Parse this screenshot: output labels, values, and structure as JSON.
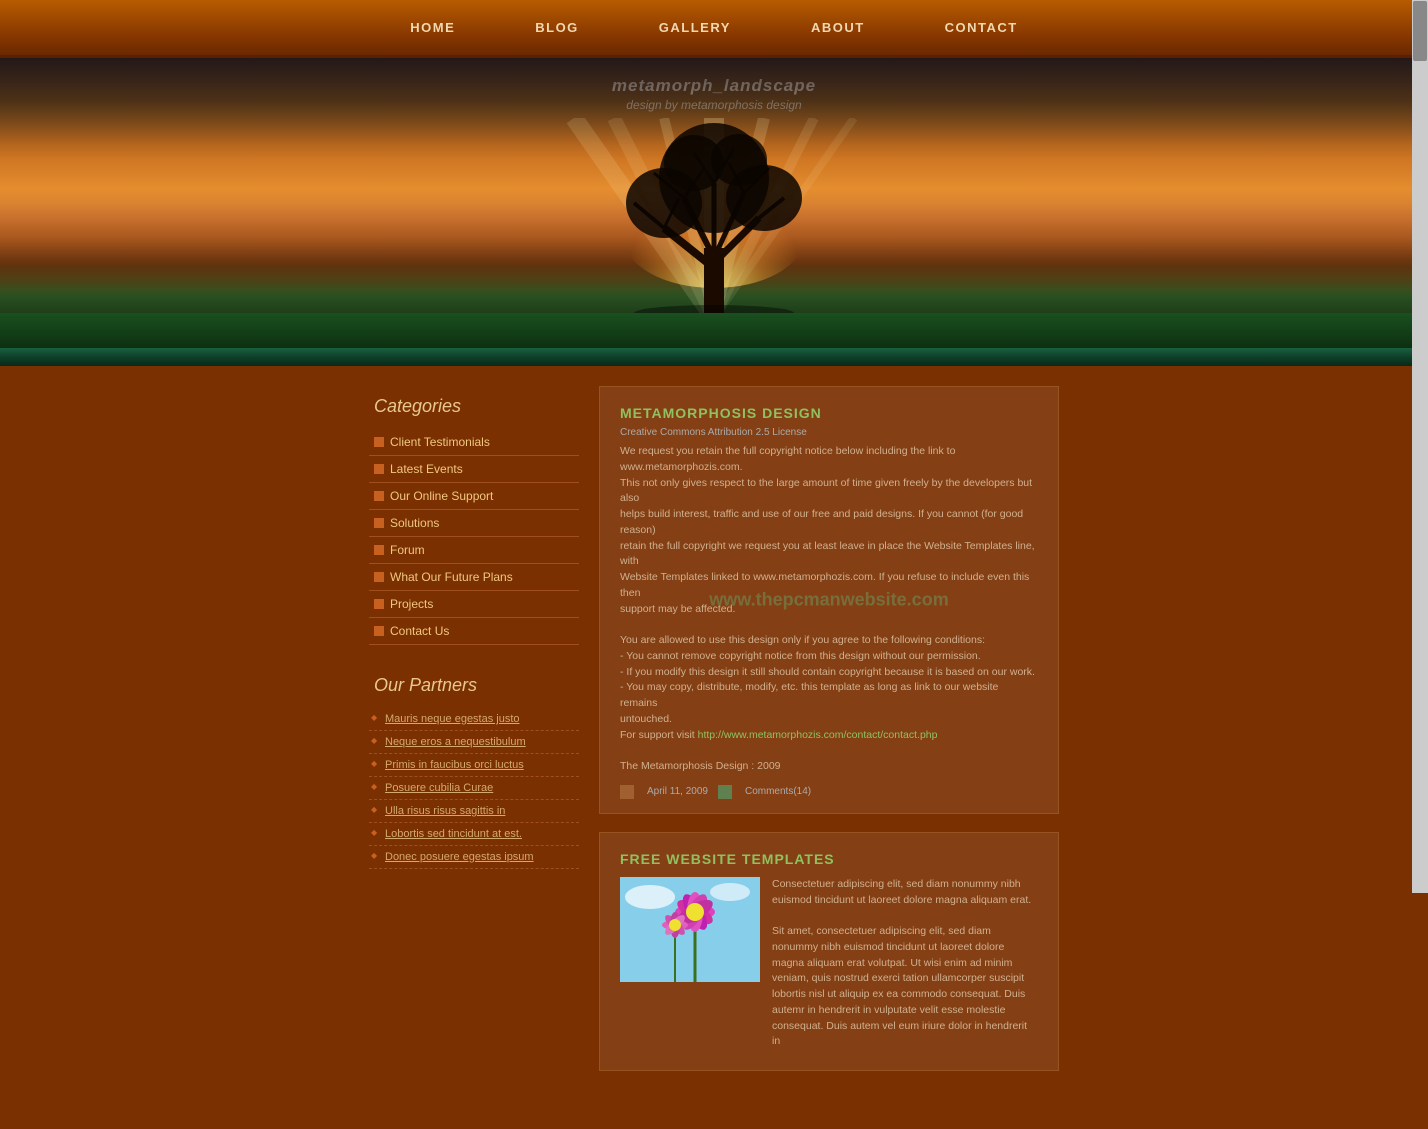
{
  "nav": {
    "items": [
      {
        "label": "HOME",
        "href": "#"
      },
      {
        "label": "BLOG",
        "href": "#"
      },
      {
        "label": "GALLERY",
        "href": "#"
      },
      {
        "label": "ABOUT",
        "href": "#"
      },
      {
        "label": "CONTACT",
        "href": "#"
      }
    ]
  },
  "banner": {
    "title": "metamorph_landscape",
    "subtitle": "design by metamorphosis design"
  },
  "sidebar": {
    "categories_title": "Categories",
    "categories": [
      {
        "label": "Client Testimonials"
      },
      {
        "label": "Latest Events"
      },
      {
        "label": "Our Online Support"
      },
      {
        "label": "Solutions"
      },
      {
        "label": "Forum"
      },
      {
        "label": "What Our Future Plans"
      },
      {
        "label": "Projects"
      },
      {
        "label": "Contact Us"
      }
    ],
    "partners_title": "Our Partners",
    "partners": [
      {
        "label": "Mauris neque egestas justo"
      },
      {
        "label": "Neque eros a nequestibulum"
      },
      {
        "label": "Primis in faucibus orci luctus"
      },
      {
        "label": "Posuere cubilia Curae"
      },
      {
        "label": "Ulla risus risus sagittis in"
      },
      {
        "label": "Lobortis sed tincidunt at est."
      },
      {
        "label": "Donec posuere egestas ipsum"
      }
    ]
  },
  "posts": [
    {
      "id": "metamorphosis",
      "title": "METAMORPHOSIS DESIGN",
      "watermark": "www.thepcmanwebsite.com",
      "cc_text": "Creative Commons Attribution 2.5 License",
      "body_lines": [
        "We request you retain the full copyright notice below including the link to",
        "www.metamorphozis.com.",
        "This not only gives respect to the large amount of time given freely by the developers but also",
        "helps build interest, traffic and use of our free and paid designs. If you cannot (for good reason)",
        "retain the full copyright we request you at least leave in place the Website Templates line, with",
        "Website Templates linked to www.metamorphozis.com. If you refuse to include even this then",
        "support may be affected.",
        "",
        "You are allowed to use this design only if you agree to the following conditions:",
        "- You cannot remove copyright notice from this design without our permission.",
        "- If you modify this design it still should contain copyright because it is based on our work.",
        "- You may copy, distribute, modify, etc. this template as long as link to our website remains",
        "untouched.",
        "For support visit http://www.metamorphozis.com/contact/contact.php",
        "",
        "The Metamorphosis Design : 2009"
      ],
      "support_url": "http://www.metamorphozis.com/contact/contact.php",
      "date": "April 11, 2009",
      "comments": "Comments(14)"
    },
    {
      "id": "free-templates",
      "title": "FREE WEBSITE TEMPLATES",
      "body_text": "Consectetuer adipiscing elit, sed diam nonummy nibh euismod tincidunt ut laoreet dolore magna aliquam erat.\n\nSit amet, consectetuer adipiscing elit, sed diam nonummy nibh euismod tincidunt ut laoreet dolore magna aliquam erat volutpat. Ut wisi enim ad minim veniam, quis nostrud exerci tation ullamcorper suscipit lobortis nisl ut aliquip ex ea commodo consequat. Duis autemr in hendrerit in vulputate velit esse molestie consequat. Duis autem vel eum iriure dolor in hendrerit in"
    }
  ]
}
